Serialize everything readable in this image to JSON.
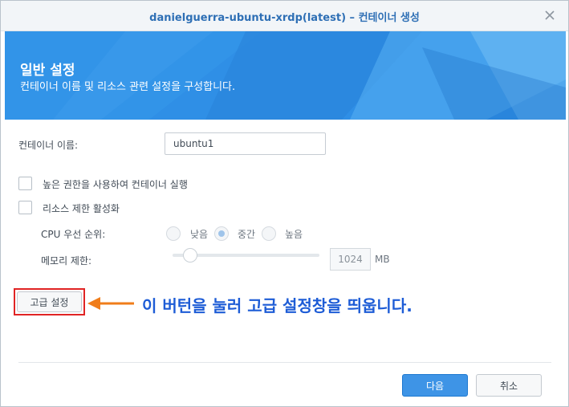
{
  "window": {
    "title_main": "danielguerra-ubuntu-xrdp(latest)",
    "title_suffix": " – 컨테이너 생성",
    "close_icon": "close-icon"
  },
  "banner": {
    "title": "일반 설정",
    "subtitle": "컨테이너 이름 및 리소스 관련 설정을 구성합니다."
  },
  "form": {
    "container_name_label": "컨테이너 이름:",
    "container_name_value": "ubuntu1",
    "privileged_label": "높은 권한을 사용하여 컨테이너 실행",
    "privileged_checked": false,
    "resource_limit_label": "리소스 제한 활성화",
    "resource_limit_checked": false,
    "cpu_priority_label": "CPU 우선 순위:",
    "cpu_options": [
      "낮음",
      "중간",
      "높음"
    ],
    "cpu_selected": "중간",
    "memory_limit_label": "메모리 제한:",
    "memory_value": "1024",
    "memory_unit": "MB",
    "memory_slider_fraction": 0.12
  },
  "advanced_button_label": "고급 설정",
  "annotation_text": "이 버턴을 눌러 고급 설정창을 띄웁니다.",
  "footer": {
    "next_label": "다음",
    "cancel_label": "취소"
  },
  "colors": {
    "accent": "#3e94e6",
    "banner": "#2e8ee5",
    "annotation": "#1d5cd6",
    "arrow": "#f07d1a",
    "highlight": "#e02424"
  }
}
